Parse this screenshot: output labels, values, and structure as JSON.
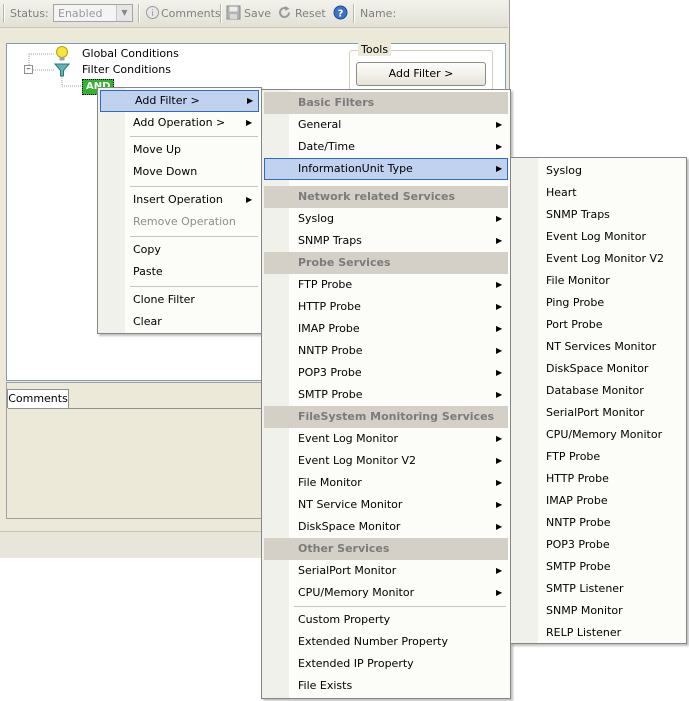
{
  "toolbar": {
    "status_label": "Status:",
    "status_value": "Enabled",
    "comments_label": "Comments",
    "save_label": "Save",
    "reset_label": "Reset",
    "name_label": "Name:"
  },
  "tree": {
    "global_conditions": "Global Conditions",
    "filter_conditions": "Filter Conditions",
    "and_node": "AND"
  },
  "tools": {
    "legend": "Tools",
    "add_filter_button": "Add Filter >"
  },
  "comments_tab": "Comments",
  "context_menu": {
    "items": [
      {
        "label": "Add Filter >",
        "submenu": true,
        "highlighted": true
      },
      {
        "label": "Add Operation >",
        "submenu": true
      },
      {
        "label": "Move Up"
      },
      {
        "label": "Move Down"
      },
      {
        "label": "Insert Operation",
        "submenu": true
      },
      {
        "label": "Remove Operation",
        "disabled": true
      },
      {
        "label": "Copy"
      },
      {
        "label": "Paste"
      },
      {
        "label": "Clone Filter"
      },
      {
        "label": "Clear"
      }
    ]
  },
  "filter_menu": {
    "sections": {
      "basic": "Basic Filters",
      "network": "Network related Services",
      "probe": "Probe Services",
      "filesystem": "FileSystem Monitoring Services",
      "other": "Other Services"
    },
    "items": {
      "general": "General",
      "datetime": "Date/Time",
      "infounit": "InformationUnit Type",
      "syslog": "Syslog",
      "snmp_traps": "SNMP Traps",
      "ftp_probe": "FTP Probe",
      "http_probe": "HTTP Probe",
      "imap_probe": "IMAP Probe",
      "nntp_probe": "NNTP Probe",
      "pop3_probe": "POP3 Probe",
      "smtp_probe": "SMTP Probe",
      "event_log_monitor": "Event Log Monitor",
      "event_log_monitor_v2": "Event Log Monitor V2",
      "file_monitor": "File Monitor",
      "nt_service_monitor": "NT Service Monitor",
      "diskspace_monitor": "DiskSpace Monitor",
      "serialport_monitor": "SerialPort Monitor",
      "cpu_memory_monitor": "CPU/Memory Monitor",
      "custom_property": "Custom Property",
      "extended_number_property": "Extended Number Property",
      "extended_ip_property": "Extended IP Property",
      "file_exists": "File Exists"
    }
  },
  "infounit_menu": {
    "items": [
      "Syslog",
      "Heart",
      "SNMP Traps",
      "Event Log Monitor",
      "Event Log Monitor V2",
      "File Monitor",
      "Ping Probe",
      "Port Probe",
      "NT Services Monitor",
      "DiskSpace Monitor",
      "Database Monitor",
      "SerialPort Monitor",
      "CPU/Memory Monitor",
      "FTP Probe",
      "HTTP Probe",
      "IMAP Probe",
      "NNTP Probe",
      "POP3 Probe",
      "SMTP Probe",
      "SMTP Listener",
      "SNMP Monitor",
      "RELP Listener"
    ]
  }
}
